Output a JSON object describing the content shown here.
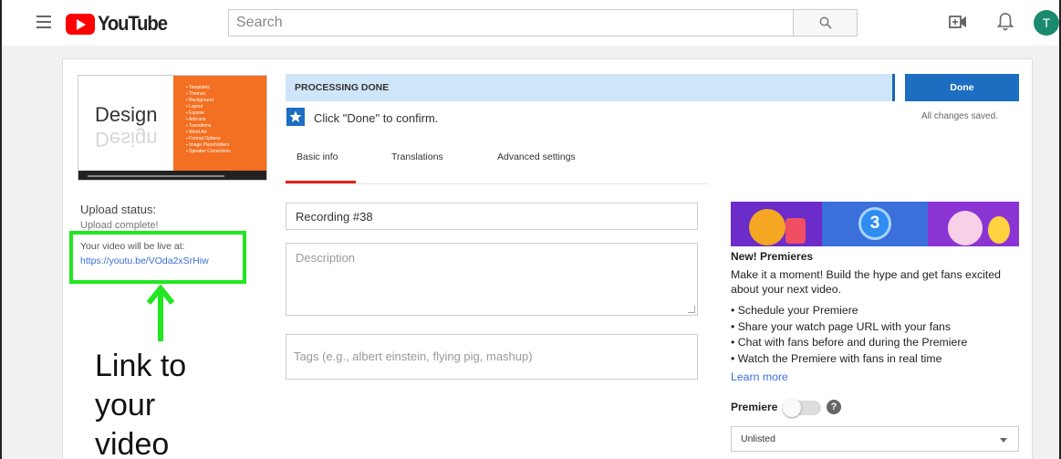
{
  "header": {
    "logo_text": "YouTube",
    "search_placeholder": "Search",
    "avatar_initial": "T"
  },
  "thumbnail": {
    "title": "Design",
    "reflection": "Design",
    "list_items": [
      "Templates",
      "Themes",
      "Background",
      "Layout",
      "Expose",
      "Add-ons",
      "Transitions",
      "Word Art",
      "Format Options",
      "Image Placeholders",
      "Speaker Corrections"
    ]
  },
  "upload": {
    "status_label": "Upload status:",
    "status_value": "Upload complete!",
    "live_label": "Your video will be live at:",
    "live_link": "https://youtu.be/VOda2xSrHiw"
  },
  "annotation": {
    "line1": "Link to",
    "line2": "your",
    "line3": "video"
  },
  "processing": {
    "status": "PROCESSING DONE",
    "done_button": "Done",
    "saved_text": "All changes saved.",
    "confirm_text": "Click \"Done\" to confirm."
  },
  "tabs": [
    {
      "label": "Basic info"
    },
    {
      "label": "Translations"
    },
    {
      "label": "Advanced settings"
    }
  ],
  "form": {
    "title_value": "Recording #38",
    "description_placeholder": "Description",
    "tags_placeholder": "Tags (e.g., albert einstein, flying pig, mashup)"
  },
  "premieres": {
    "banner_number": "3",
    "title": "New! Premieres",
    "text": "Make it a moment! Build the hype and get fans excited about your next video.",
    "bullets": [
      "Schedule your Premiere",
      "Share your watch page URL with your fans",
      "Chat with fans before and during the Premiere",
      "Watch the Premiere with fans in real time"
    ],
    "learn_more": "Learn more",
    "premiere_label": "Premiere",
    "help_glyph": "?",
    "visibility_value": "Unlisted"
  },
  "colors": {
    "brand_red": "#ff0000",
    "accent_blue": "#1c6ec1",
    "callout_green": "#22e620"
  }
}
